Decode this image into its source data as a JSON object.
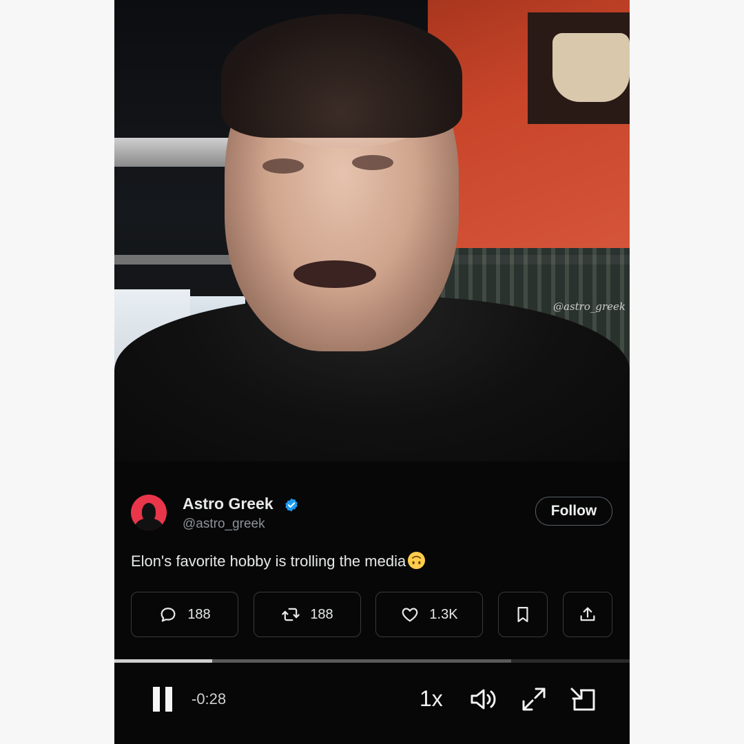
{
  "video": {
    "watermark": "@astro_greek"
  },
  "post": {
    "author_name": "Astro Greek",
    "author_handle": "@astro_greek",
    "follow_label": "Follow",
    "text": "Elon's favorite hobby is trolling the media",
    "emoji": "upside-down-face-emoji",
    "verified": true
  },
  "actions": {
    "replies": "188",
    "reposts": "188",
    "likes": "1.3K"
  },
  "player": {
    "time_remaining": "-0:28",
    "speed": "1x",
    "progress_fraction": 0.19,
    "buffered_fraction": 0.77
  },
  "icons": {
    "reply": "reply-bubble-icon",
    "repost": "repost-arrows-icon",
    "like": "heart-icon",
    "bookmark": "bookmark-icon",
    "share": "share-upload-icon",
    "pause": "pause-icon",
    "volume": "volume-icon",
    "fullscreen": "expand-icon",
    "popout": "picture-in-picture-icon",
    "verified": "verified-badge-icon"
  },
  "colors": {
    "accent_verified": "#1d9bf0",
    "avatar_bg": "#e9364a",
    "background": "#000000"
  }
}
